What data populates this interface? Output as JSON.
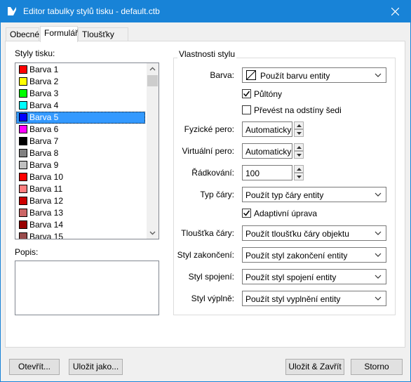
{
  "window": {
    "title": "Editor tabulky stylů tisku - default.ctb"
  },
  "tabs": [
    {
      "label": "Obecné"
    },
    {
      "label": "Formulář"
    },
    {
      "label": "Tloušťky čar"
    }
  ],
  "left": {
    "styles_label": "Styly tisku:",
    "styles": [
      {
        "name": "Barva 1",
        "color": "#ff0000"
      },
      {
        "name": "Barva 2",
        "color": "#ffff00"
      },
      {
        "name": "Barva 3",
        "color": "#00ff00"
      },
      {
        "name": "Barva 4",
        "color": "#00ffff"
      },
      {
        "name": "Barva 5",
        "color": "#0000ff"
      },
      {
        "name": "Barva 6",
        "color": "#ff00ff"
      },
      {
        "name": "Barva 7",
        "color": "#000000"
      },
      {
        "name": "Barva 8",
        "color": "#808080"
      },
      {
        "name": "Barva 9",
        "color": "#c0c0c0"
      },
      {
        "name": "Barva 10",
        "color": "#ff0000"
      },
      {
        "name": "Barva 11",
        "color": "#ff7f7f"
      },
      {
        "name": "Barva 12",
        "color": "#cc0000"
      },
      {
        "name": "Barva 13",
        "color": "#cc6666"
      },
      {
        "name": "Barva 14",
        "color": "#990000"
      },
      {
        "name": "Barva 15",
        "color": "#994c4c"
      }
    ],
    "selected_index": 4,
    "description_label": "Popis:",
    "description_value": ""
  },
  "properties": {
    "group_title": "Vlastnosti stylu",
    "color": {
      "label": "Barva:",
      "value": "Použít barvu entity"
    },
    "halftone": {
      "label": "Půltóny",
      "checked": true
    },
    "grayscale": {
      "label": "Převést na odstíny šedi",
      "checked": false
    },
    "physical_pen": {
      "label": "Fyzické pero:",
      "value": "Automaticky"
    },
    "virtual_pen": {
      "label": "Virtuální pero:",
      "value": "Automaticky"
    },
    "screening": {
      "label": "Řádkování:",
      "value": "100"
    },
    "linetype": {
      "label": "Typ čáry:",
      "value": "Použít typ čáry entity"
    },
    "adaptive": {
      "label": "Adaptivní úprava",
      "checked": true
    },
    "lineweight": {
      "label": "Tloušťka čáry:",
      "value": "Použít tloušťku čáry objektu"
    },
    "endstyle": {
      "label": "Styl zakončení:",
      "value": "Použít styl zakončení entity"
    },
    "joinstyle": {
      "label": "Styl spojení:",
      "value": "Použít styl spojení entity"
    },
    "fillstyle": {
      "label": "Styl výplně:",
      "value": "Použít styl vyplnění entity"
    }
  },
  "buttons": {
    "open": "Otevřít...",
    "save_as": "Uložit jako...",
    "save_close": "Uložit & Zavřít",
    "cancel": "Storno"
  },
  "icons": {
    "title_icon": "app-logo-icon",
    "close": "close-icon",
    "dropdown": "chevron-down-icon",
    "color_none": "no-color-swatch-icon"
  }
}
